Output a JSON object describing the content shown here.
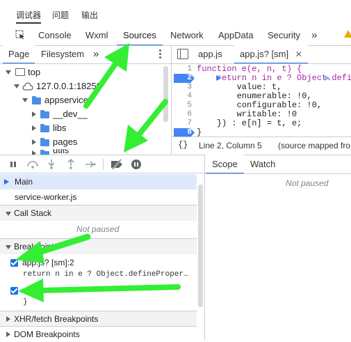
{
  "top_tabs": [
    "调试器",
    "问题",
    "输出"
  ],
  "devtools_tabs": [
    "Console",
    "Wxml",
    "Sources",
    "Network",
    "AppData",
    "Security",
    "»"
  ],
  "navigator": {
    "tabs": [
      "Page",
      "Filesystem",
      "»"
    ],
    "tree": [
      "top",
      "127.0.0.1:18250",
      "appservice",
      "__dev__",
      "libs",
      "pages",
      "utils"
    ]
  },
  "editor": {
    "tabs": [
      "app.js",
      "app.js? [sm]"
    ],
    "line_numbers": [
      "1",
      "2",
      "3",
      "4",
      "5",
      "6",
      "7",
      "8"
    ],
    "lines": [
      "function e(e, n, t) {",
      "    return n in e ? Object.defi",
      "        value: t,",
      "        enumerable: !0,",
      "        configurable: !0,",
      "        writable: !0",
      "    }) : e[n] = t, e;",
      "}"
    ],
    "status_cursor": "Line 2, Column 5",
    "status_source": "(source mapped fro",
    "format_glyph": "{}"
  },
  "threads": {
    "main": "Main",
    "worker": "service-worker.js"
  },
  "call_stack": {
    "title": "Call Stack",
    "empty": "Not paused"
  },
  "breakpoints": {
    "title": "Breakpoints",
    "items": [
      {
        "file": "app.js? [sm]:2",
        "code": "return n in e ? Object.defineProper…",
        "checked": true
      },
      {
        "file": "",
        "code": "}",
        "checked": true
      }
    ]
  },
  "xhr": {
    "title": "XHR/fetch Breakpoints"
  },
  "dom": {
    "title": "DOM Breakpoints"
  },
  "scope_tabs": [
    "Scope",
    "Watch"
  ],
  "scope_empty": "Not paused",
  "colors": {
    "accent": "#1a73e8",
    "annotation": "#33ee33",
    "breakpoint": "#4285f4"
  }
}
